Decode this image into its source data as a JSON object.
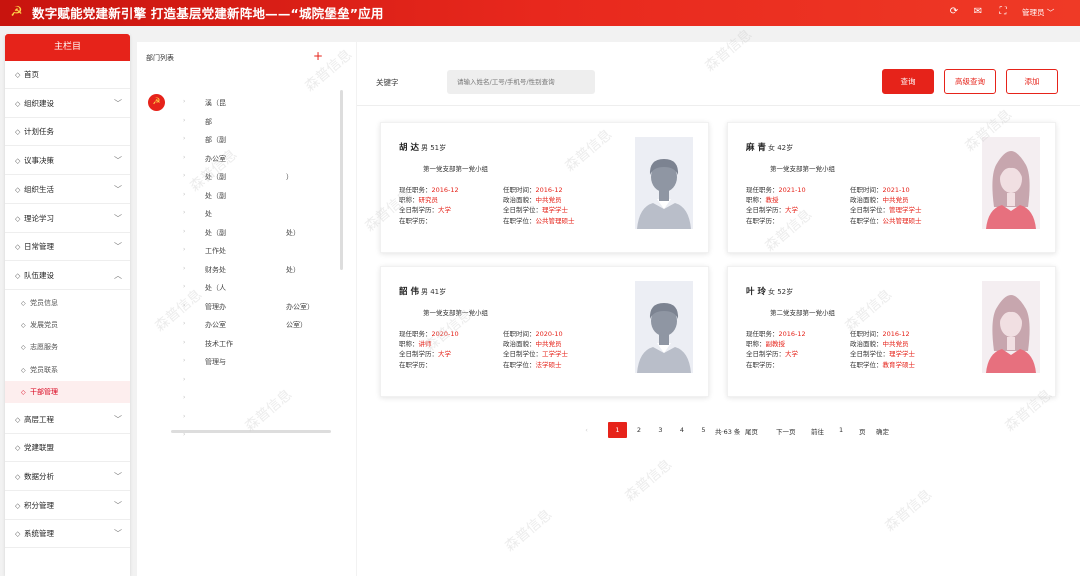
{
  "header": {
    "title": "数字赋能党建新引擎 打造基层党建新阵地——“城院堡垒”应用",
    "user": "管理员",
    "icons": [
      "refresh-icon",
      "message-icon",
      "fullscreen-icon",
      "user-icon"
    ]
  },
  "sidebar": {
    "title": "主栏目",
    "items": [
      {
        "label": "首页",
        "chevron": ""
      },
      {
        "label": "组织建设",
        "chevron": "﹀"
      },
      {
        "label": "计划任务",
        "chevron": ""
      },
      {
        "label": "议事决策",
        "chevron": "﹀"
      },
      {
        "label": "组织生活",
        "chevron": "﹀"
      },
      {
        "label": "理论学习",
        "chevron": "﹀"
      },
      {
        "label": "日常管理",
        "chevron": "﹀"
      },
      {
        "label": "队伍建设",
        "chevron": "︿"
      }
    ],
    "subitems": [
      "党员信息",
      "发展党员",
      "志愿服务",
      "党员联系",
      "干部管理"
    ],
    "items_after": [
      {
        "label": "高层工程",
        "chevron": "﹀"
      },
      {
        "label": "党建联盟",
        "chevron": ""
      },
      {
        "label": "数据分析",
        "chevron": "﹀"
      },
      {
        "label": "积分管理",
        "chevron": "﹀"
      },
      {
        "label": "系统管理",
        "chevron": "﹀"
      }
    ]
  },
  "dept": {
    "title": "部门列表",
    "add": "+",
    "nodes": [
      "溪（昆",
      "部",
      "部（副",
      "办公室",
      "处（副",
      "处（副",
      "处",
      "处（副",
      "工作处",
      "财务处",
      "处（人",
      "管理办",
      "办公室",
      "技术工作",
      "管理与",
      "",
      "",
      "",
      ""
    ],
    "nodes_right": [
      "",
      "",
      "",
      "",
      "）",
      "",
      "",
      "处）",
      "",
      "处）",
      "",
      "办公室）",
      "公室）",
      "",
      "",
      "",
      "",
      "",
      ""
    ]
  },
  "search": {
    "label": "关键字",
    "placeholder": "请输入姓名/工号/手机号/性别查询",
    "query": "查询",
    "advanced": "高级查询",
    "add": "添加"
  },
  "cards": [
    {
      "name": "胡 达",
      "meta": "男 51岁",
      "dept": "第一党支部第一党小组",
      "gender": "male",
      "f1": "现任职务：",
      "v1": "2016-12",
      "f2": "任职时间：",
      "v2": "2016-12",
      "f3": "职称：",
      "v3": "研究员",
      "f4": "政治面貌：",
      "v4": "中共党员",
      "f5": "全日制学历：",
      "v5": "大学",
      "f6": "全日制学位：",
      "v6": "理学学士",
      "f7": "在职学历：",
      "v7": "",
      "f8": "在职学位：",
      "v8": "公共管理硕士"
    },
    {
      "name": "麻 青",
      "meta": "女 42岁",
      "dept": "第一党支部第一党小组",
      "gender": "female",
      "f1": "现任职务：",
      "v1": "2021-10",
      "f2": "任职时间：",
      "v2": "2021-10",
      "f3": "职称：",
      "v3": "教授",
      "f4": "政治面貌：",
      "v4": "中共党员",
      "f5": "全日制学历：",
      "v5": "大学",
      "f6": "全日制学位：",
      "v6": "管理学学士",
      "f7": "在职学历：",
      "v7": "",
      "f8": "在职学位：",
      "v8": "公共管理硕士"
    },
    {
      "name": "韶 伟",
      "meta": "男 41岁",
      "dept": "第一党支部第一党小组",
      "gender": "male",
      "f1": "现任职务：",
      "v1": "2020-10",
      "f2": "任职时间：",
      "v2": "2020-10",
      "f3": "职称：",
      "v3": "讲师",
      "f4": "政治面貌：",
      "v4": "中共党员",
      "f5": "全日制学历：",
      "v5": "大学",
      "f6": "全日制学位：",
      "v6": "工学学士",
      "f7": "在职学历：",
      "v7": "",
      "f8": "在职学位：",
      "v8": "法学硕士"
    },
    {
      "name": "叶 玲",
      "meta": "女 52岁",
      "dept": "第二党支部第一党小组",
      "gender": "female",
      "f1": "现任职务：",
      "v1": "2016-12",
      "f2": "任职时间：",
      "v2": "2016-12",
      "f3": "职称：",
      "v3": "副教授",
      "f4": "政治面貌：",
      "v4": "中共党员",
      "f5": "全日制学历：",
      "v5": "大学",
      "f6": "全日制学位：",
      "v6": "理学学士",
      "f7": "在职学历：",
      "v7": "",
      "f8": "在职学位：",
      "v8": "教育学硕士"
    }
  ],
  "pagination": {
    "total": "共 63 条",
    "pages": [
      "1",
      "2",
      "3",
      "4",
      "5"
    ],
    "ellipsis": "...",
    "last": "尾页",
    "next": "下一页",
    "goto": "前往",
    "page_value": "1",
    "page_unit": "页",
    "confirm": "确定"
  },
  "watermark": "森普信息"
}
